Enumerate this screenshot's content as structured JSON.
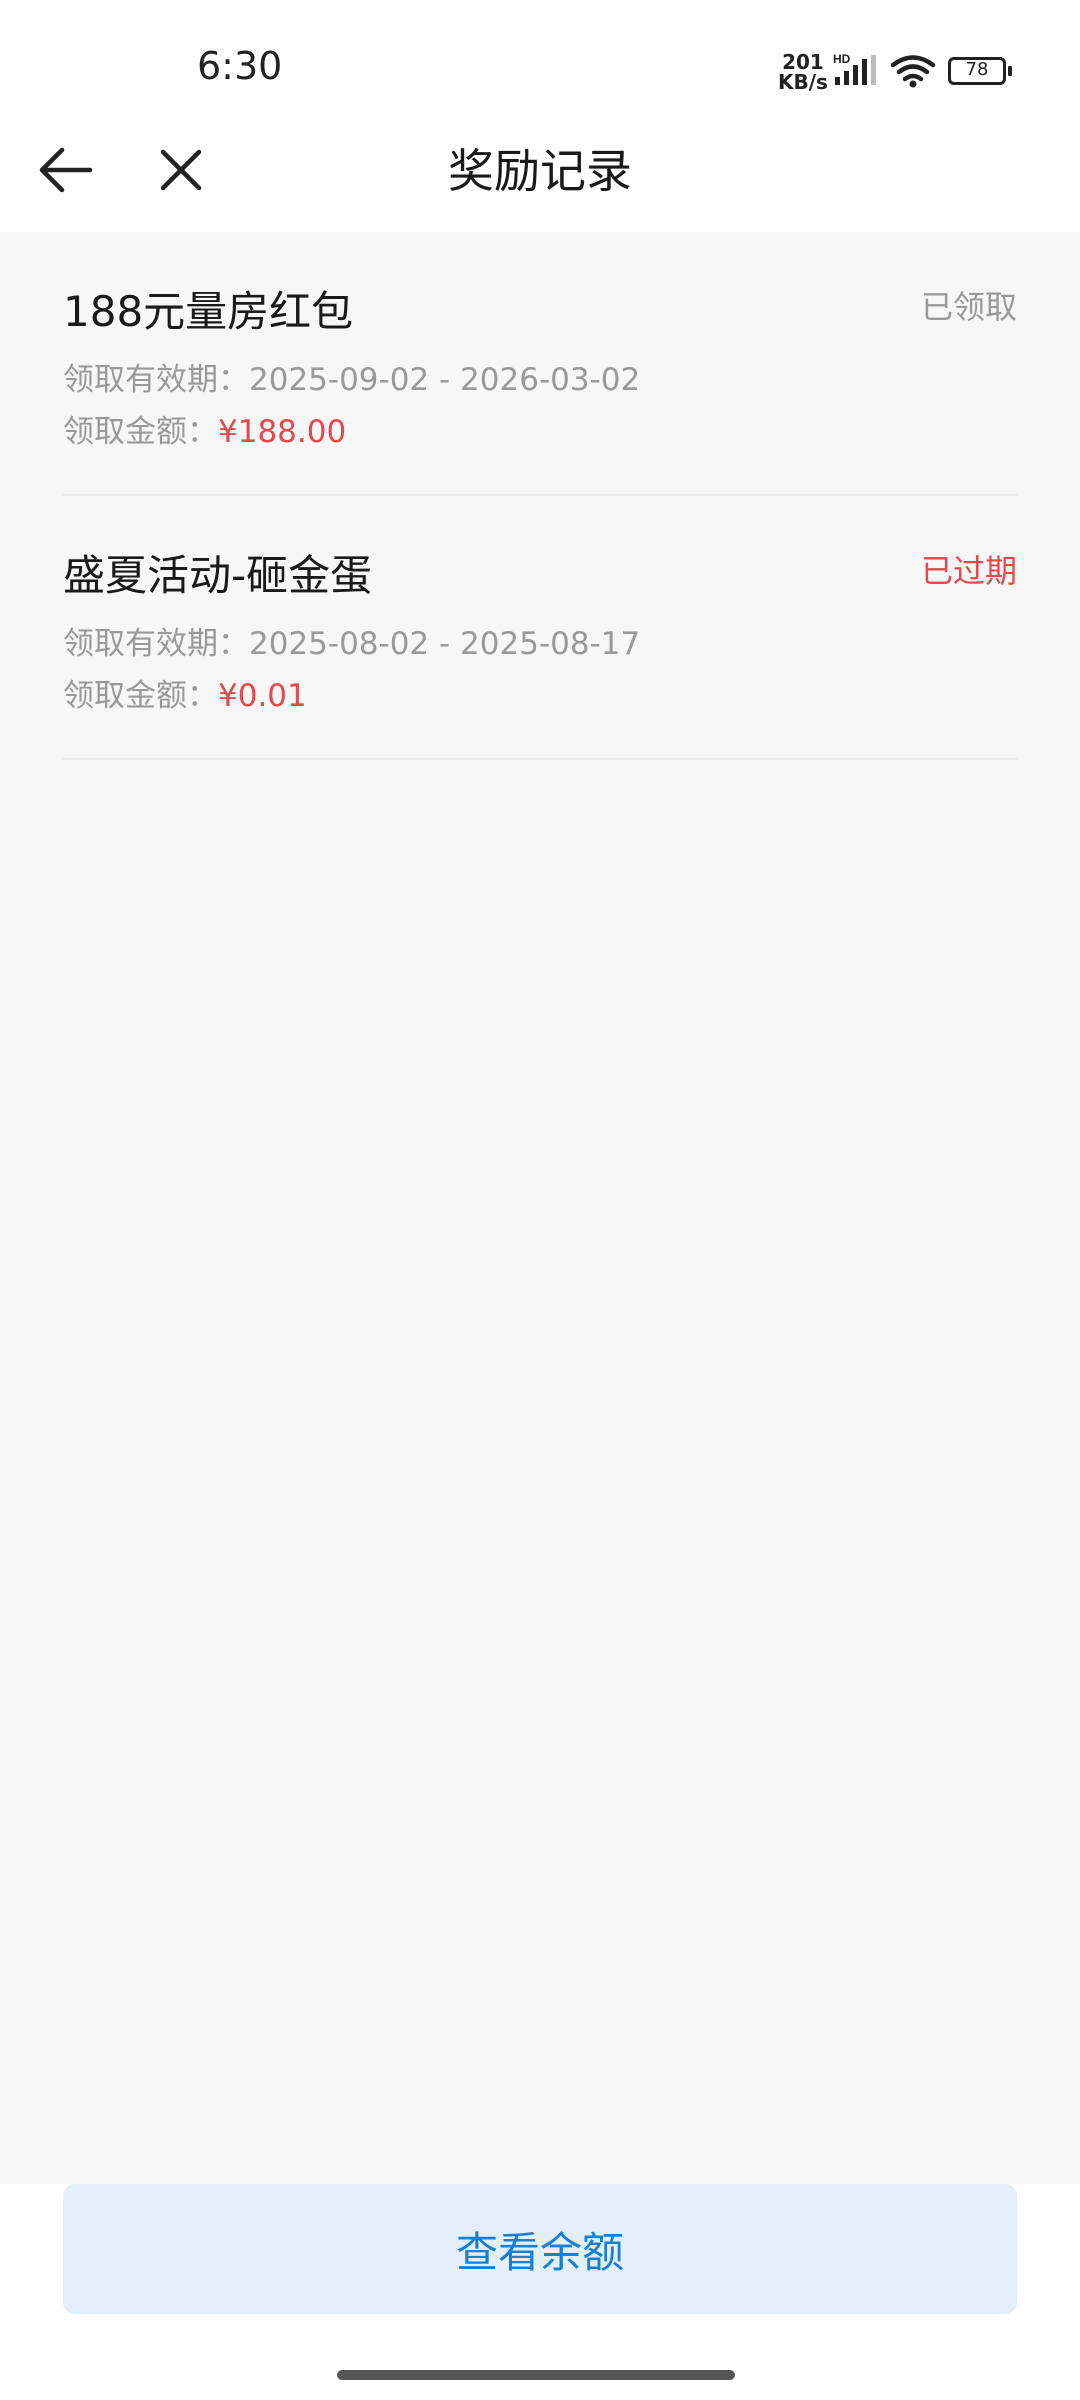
{
  "status_bar": {
    "time": "6:30",
    "net_speed_value": "201",
    "net_speed_unit": "KB/s",
    "network_badge": "HD",
    "battery": "78"
  },
  "nav": {
    "title": "奖励记录",
    "back_icon": "arrow-left-icon",
    "close_icon": "close-icon"
  },
  "rewards": [
    {
      "title": "188元量房红包",
      "status": "已领取",
      "status_color": "#999999",
      "validity_label": "领取有效期：",
      "validity": "2025-09-02 - 2026-03-02",
      "amount_label": "领取金额：",
      "amount": "¥188.00"
    },
    {
      "title": "盛夏活动-砸金蛋",
      "status": "已过期",
      "status_color": "#e5484d",
      "validity_label": "领取有效期：",
      "validity": "2025-08-02 - 2025-08-17",
      "amount_label": "领取金额：",
      "amount": "¥0.01"
    }
  ],
  "footer": {
    "balance_button": "查看余额"
  },
  "colors": {
    "accent": "#1a7fd4",
    "accent_bg": "#e3effb",
    "amount": "#e5484d",
    "page_bg": "#f7f7f7"
  }
}
